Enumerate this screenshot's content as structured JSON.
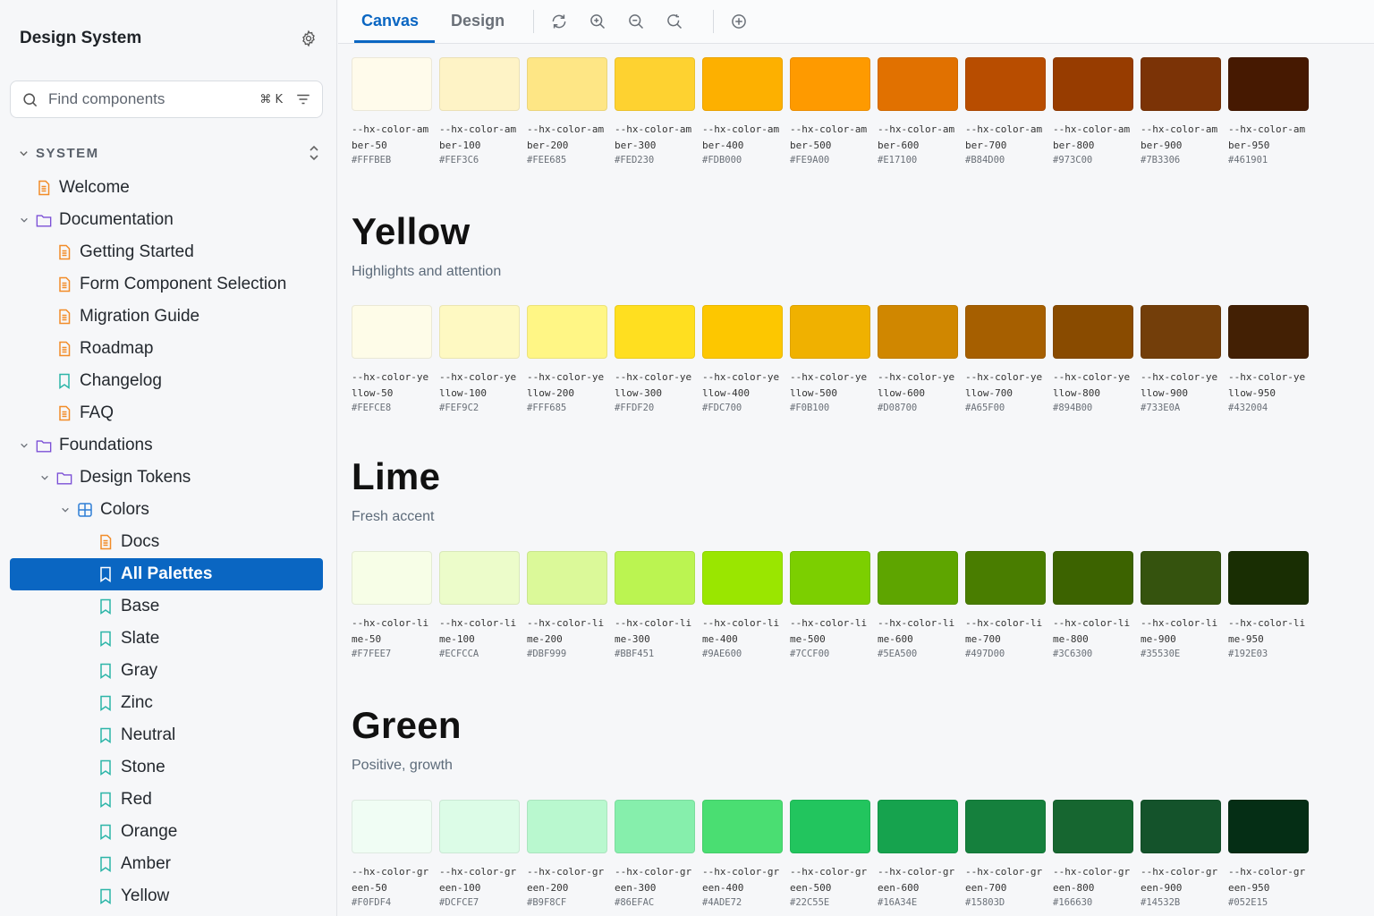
{
  "sidebar": {
    "title": "Design System",
    "search": {
      "placeholder": "Find components",
      "shortcut": "⌘ K"
    },
    "section_label": "SYSTEM",
    "tree": [
      {
        "label": "Welcome",
        "depth": 0,
        "icon": "doc",
        "caret": ""
      },
      {
        "label": "Documentation",
        "depth": 0,
        "icon": "folder",
        "caret": "open"
      },
      {
        "label": "Getting Started",
        "depth": 1,
        "icon": "doc",
        "caret": ""
      },
      {
        "label": "Form Component Selection",
        "depth": 1,
        "icon": "doc",
        "caret": ""
      },
      {
        "label": "Migration Guide",
        "depth": 1,
        "icon": "doc",
        "caret": ""
      },
      {
        "label": "Roadmap",
        "depth": 1,
        "icon": "doc",
        "caret": ""
      },
      {
        "label": "Changelog",
        "depth": 1,
        "icon": "bookmark",
        "caret": ""
      },
      {
        "label": "FAQ",
        "depth": 1,
        "icon": "doc",
        "caret": ""
      },
      {
        "label": "Foundations",
        "depth": 0,
        "icon": "folder",
        "caret": "open"
      },
      {
        "label": "Design Tokens",
        "depth": 1,
        "icon": "folder",
        "caret": "open"
      },
      {
        "label": "Colors",
        "depth": 2,
        "icon": "component",
        "caret": "open"
      },
      {
        "label": "Docs",
        "depth": 3,
        "icon": "doc",
        "caret": ""
      },
      {
        "label": "All Palettes",
        "depth": 3,
        "icon": "bookmark",
        "caret": "",
        "selected": true
      },
      {
        "label": "Base",
        "depth": 3,
        "icon": "bookmark",
        "caret": ""
      },
      {
        "label": "Slate",
        "depth": 3,
        "icon": "bookmark",
        "caret": ""
      },
      {
        "label": "Gray",
        "depth": 3,
        "icon": "bookmark",
        "caret": ""
      },
      {
        "label": "Zinc",
        "depth": 3,
        "icon": "bookmark",
        "caret": ""
      },
      {
        "label": "Neutral",
        "depth": 3,
        "icon": "bookmark",
        "caret": ""
      },
      {
        "label": "Stone",
        "depth": 3,
        "icon": "bookmark",
        "caret": ""
      },
      {
        "label": "Red",
        "depth": 3,
        "icon": "bookmark",
        "caret": ""
      },
      {
        "label": "Orange",
        "depth": 3,
        "icon": "bookmark",
        "caret": ""
      },
      {
        "label": "Amber",
        "depth": 3,
        "icon": "bookmark",
        "caret": ""
      },
      {
        "label": "Yellow",
        "depth": 3,
        "icon": "bookmark",
        "caret": ""
      }
    ]
  },
  "toolbar": {
    "tabs": [
      "Canvas",
      "Design"
    ],
    "active_tab": "Canvas",
    "tools": [
      "refresh-icon",
      "zoom-in-icon",
      "zoom-out-icon",
      "reset-zoom-icon",
      "add-icon"
    ]
  },
  "palettes": [
    {
      "name": "amber",
      "title": "",
      "description": "",
      "swatches": [
        {
          "name": "--hx-color-amber-50",
          "hex": "#FFFBEB"
        },
        {
          "name": "--hx-color-amber-100",
          "hex": "#FEF3C6"
        },
        {
          "name": "--hx-color-amber-200",
          "hex": "#FEE685"
        },
        {
          "name": "--hx-color-amber-300",
          "hex": "#FED230"
        },
        {
          "name": "--hx-color-amber-400",
          "hex": "#FDB000"
        },
        {
          "name": "--hx-color-amber-500",
          "hex": "#FE9A00"
        },
        {
          "name": "--hx-color-amber-600",
          "hex": "#E17100"
        },
        {
          "name": "--hx-color-amber-700",
          "hex": "#B84D00"
        },
        {
          "name": "--hx-color-amber-800",
          "hex": "#973C00"
        },
        {
          "name": "--hx-color-amber-900",
          "hex": "#7B3306"
        },
        {
          "name": "--hx-color-amber-950",
          "hex": "#461901"
        }
      ]
    },
    {
      "name": "yellow",
      "title": "Yellow",
      "description": "Highlights and attention",
      "swatches": [
        {
          "name": "--hx-color-yellow-50",
          "hex": "#FEFCE8"
        },
        {
          "name": "--hx-color-yellow-100",
          "hex": "#FEF9C2"
        },
        {
          "name": "--hx-color-yellow-200",
          "hex": "#FFF685"
        },
        {
          "name": "--hx-color-yellow-300",
          "hex": "#FFDF20"
        },
        {
          "name": "--hx-color-yellow-400",
          "hex": "#FDC700"
        },
        {
          "name": "--hx-color-yellow-500",
          "hex": "#F0B100"
        },
        {
          "name": "--hx-color-yellow-600",
          "hex": "#D08700"
        },
        {
          "name": "--hx-color-yellow-700",
          "hex": "#A65F00"
        },
        {
          "name": "--hx-color-yellow-800",
          "hex": "#894B00"
        },
        {
          "name": "--hx-color-yellow-900",
          "hex": "#733E0A"
        },
        {
          "name": "--hx-color-yellow-950",
          "hex": "#432004"
        }
      ]
    },
    {
      "name": "lime",
      "title": "Lime",
      "description": "Fresh accent",
      "swatches": [
        {
          "name": "--hx-color-lime-50",
          "hex": "#F7FEE7"
        },
        {
          "name": "--hx-color-lime-100",
          "hex": "#ECFCCA"
        },
        {
          "name": "--hx-color-lime-200",
          "hex": "#DBF999"
        },
        {
          "name": "--hx-color-lime-300",
          "hex": "#BBF451"
        },
        {
          "name": "--hx-color-lime-400",
          "hex": "#9AE600"
        },
        {
          "name": "--hx-color-lime-500",
          "hex": "#7CCF00"
        },
        {
          "name": "--hx-color-lime-600",
          "hex": "#5EA500"
        },
        {
          "name": "--hx-color-lime-700",
          "hex": "#497D00"
        },
        {
          "name": "--hx-color-lime-800",
          "hex": "#3C6300"
        },
        {
          "name": "--hx-color-lime-900",
          "hex": "#35530E"
        },
        {
          "name": "--hx-color-lime-950",
          "hex": "#192E03"
        }
      ]
    },
    {
      "name": "green",
      "title": "Green",
      "description": "Positive, growth",
      "swatches": [
        {
          "name": "--hx-color-green-50",
          "hex": "#F0FDF4"
        },
        {
          "name": "--hx-color-green-100",
          "hex": "#DCFCE7"
        },
        {
          "name": "--hx-color-green-200",
          "hex": "#B9F8CF"
        },
        {
          "name": "--hx-color-green-300",
          "hex": "#86EFAC"
        },
        {
          "name": "--hx-color-green-400",
          "hex": "#4ADE72"
        },
        {
          "name": "--hx-color-green-500",
          "hex": "#22C55E"
        },
        {
          "name": "--hx-color-green-600",
          "hex": "#16A34E"
        },
        {
          "name": "--hx-color-green-700",
          "hex": "#15803D"
        },
        {
          "name": "--hx-color-green-800",
          "hex": "#166630"
        },
        {
          "name": "--hx-color-green-900",
          "hex": "#14532B"
        },
        {
          "name": "--hx-color-green-950",
          "hex": "#052E15"
        }
      ]
    }
  ],
  "colors": {
    "accent": "#0A66C2",
    "doc_icon": "#F28C28",
    "folder_icon": "#7B4FD6",
    "bookmark_icon": "#2CB5A8",
    "component_icon": "#2F7FD6"
  }
}
